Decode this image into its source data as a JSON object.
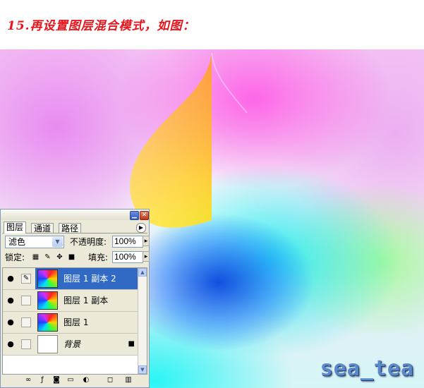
{
  "caption": "15.再设置图层混合模式，如图：",
  "watermark": "sea_tea",
  "colors": {
    "caption": "#e8141c",
    "selection": "#316ac5",
    "panel": "#ece9d8"
  },
  "palette": {
    "tabs": [
      {
        "label": "图层",
        "active": true
      },
      {
        "label": "通道",
        "active": false
      },
      {
        "label": "路径",
        "active": false
      }
    ],
    "blend_mode": "滤色",
    "opacity_label": "不透明度:",
    "opacity_value": "100%",
    "lock_label": "锁定:",
    "fill_label": "填充:",
    "fill_value": "100%",
    "layers": [
      {
        "name": "图层 1 副本 2",
        "selected": true,
        "thumb": "swirl"
      },
      {
        "name": "图层 1 副本",
        "selected": false,
        "thumb": "swirl"
      },
      {
        "name": "图层 1",
        "selected": false,
        "thumb": "swirl"
      },
      {
        "name": "背景",
        "selected": false,
        "thumb": "white",
        "locked": true
      }
    ]
  }
}
